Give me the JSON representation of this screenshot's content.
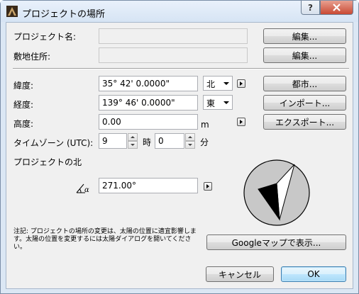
{
  "window": {
    "title": "プロジェクトの場所",
    "help_label": "?",
    "close_label": "X"
  },
  "project": {
    "name_label": "プロジェクト名:",
    "name_value": "",
    "site_label": "敷地住所:",
    "site_value": "",
    "edit_label": "編集..."
  },
  "location": {
    "latitude_label": "緯度:",
    "latitude_value": "35° 42' 0.0000\"",
    "latitude_dir": "北",
    "longitude_label": "経度:",
    "longitude_value": "139° 46' 0.0000\"",
    "longitude_dir": "東",
    "altitude_label": "高度:",
    "altitude_value": "0.00",
    "altitude_unit": "m",
    "timezone_label": "タイムゾーン (UTC):",
    "timezone_hours": "9",
    "hours_unit": "時",
    "timezone_minutes": "0",
    "minutes_unit": "分",
    "north_label": "プロジェクトの北",
    "north_angle": "271.00°"
  },
  "buttons": {
    "city": "都市...",
    "import": "インポート...",
    "export": "エクスポート...",
    "google_maps": "Googleマップで表示...",
    "cancel": "キャンセル",
    "ok": "OK"
  },
  "note": {
    "line1": "注記: プロジェクトの場所の変更は、太陽の位置に適宜影響しま",
    "line2": "す。太陽の位置を変更するには太陽ダイアログを開いてくださ",
    "line3": "い。"
  },
  "colors": {
    "window_frame": "#dbe7f4",
    "dialog_bg": "#f0f0f0",
    "close_red": "#c94a34"
  },
  "icons": {
    "app": "archicad-icon",
    "angle": "angle-icon",
    "compass": "north-arrow-compass"
  }
}
